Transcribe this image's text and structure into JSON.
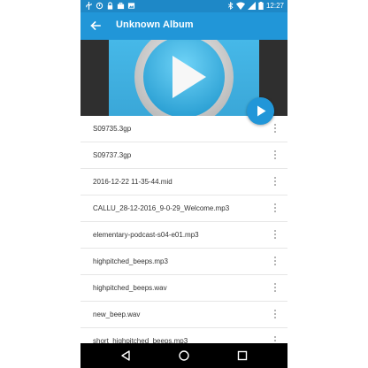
{
  "status_bar": {
    "time": "12:27",
    "icons": [
      "usb-icon",
      "sync-icon",
      "lock-icon",
      "briefcase-icon",
      "image-icon",
      "bluetooth-icon",
      "wifi-icon",
      "signal-icon",
      "battery-icon"
    ]
  },
  "app_bar": {
    "title": "Unknown Album",
    "back_icon": "arrow-back-icon"
  },
  "album": {
    "art_icon": "play-icon"
  },
  "fab": {
    "icon": "play-icon"
  },
  "tracks": [
    {
      "label": "S09735.3gp"
    },
    {
      "label": "S09737.3gp"
    },
    {
      "label": "2016-12-22 11-35-44.mid"
    },
    {
      "label": "CALLU_28-12-2016_9-0-29_Welcome.mp3"
    },
    {
      "label": "elementary-podcast-s04-e01.mp3"
    },
    {
      "label": "highpitched_beeps.mp3"
    },
    {
      "label": "highpitched_beeps.wav"
    },
    {
      "label": "new_beep.wav"
    },
    {
      "label": "short_highpitched_beeps.mp3"
    }
  ],
  "nav_bar": {
    "back_icon": "nav-back-icon",
    "home_icon": "nav-home-icon",
    "recents_icon": "nav-recents-icon"
  },
  "colors": {
    "primary": "#2196d8",
    "primary_dark": "#1e88c7",
    "text": "#333333",
    "divider": "#e6e6e6"
  }
}
